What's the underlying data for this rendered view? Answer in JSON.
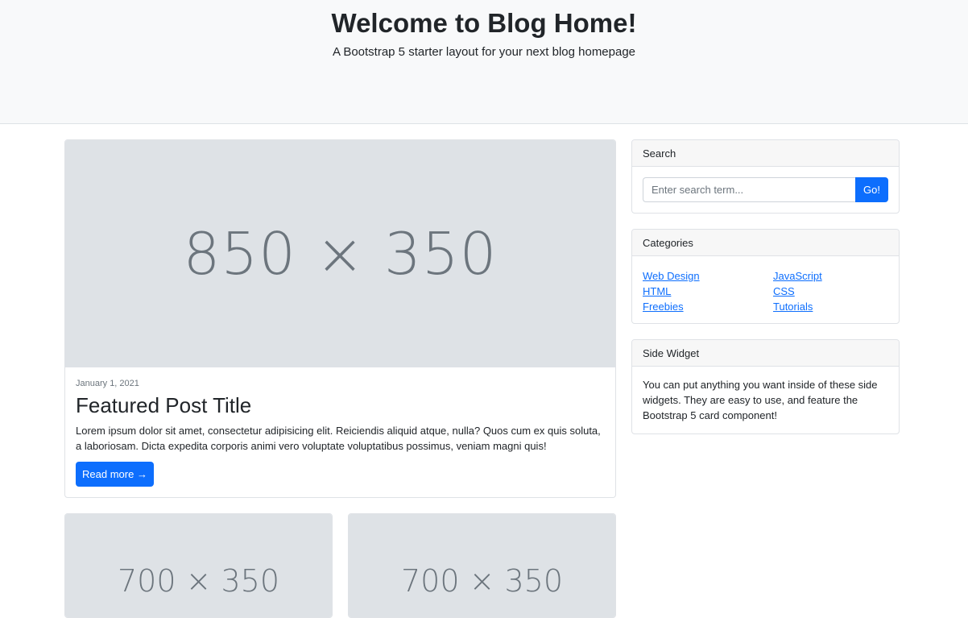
{
  "header": {
    "title": "Welcome to Blog Home!",
    "subtitle": "A Bootstrap 5 starter layout for your next blog homepage"
  },
  "featured_post": {
    "image_label": "850 × 350",
    "date": "January 1, 2021",
    "title": "Featured Post Title",
    "text": "Lorem ipsum dolor sit amet, consectetur adipisicing elit. Reiciendis aliquid atque, nulla? Quos cum ex quis soluta, a laboriosam. Dicta expedita corporis animi vero voluptate voluptatibus possimus, veniam magni quis!",
    "button_label": "Read more →"
  },
  "posts": [
    {
      "image_label": "700 × 350"
    },
    {
      "image_label": "700 × 350"
    }
  ],
  "search": {
    "header": "Search",
    "placeholder": "Enter search term...",
    "button_label": "Go!"
  },
  "categories": {
    "header": "Categories",
    "left": [
      "Web Design",
      "HTML",
      "Freebies"
    ],
    "right": [
      "JavaScript",
      "CSS",
      "Tutorials"
    ]
  },
  "side_widget": {
    "header": "Side Widget",
    "text": "You can put anything you want inside of these side widgets. They are easy to use, and feature the Bootstrap 5 card component!"
  },
  "colors": {
    "primary": "#0d6efd",
    "header_bg": "#f8f9fa",
    "placeholder_bg": "#dee2e6"
  }
}
